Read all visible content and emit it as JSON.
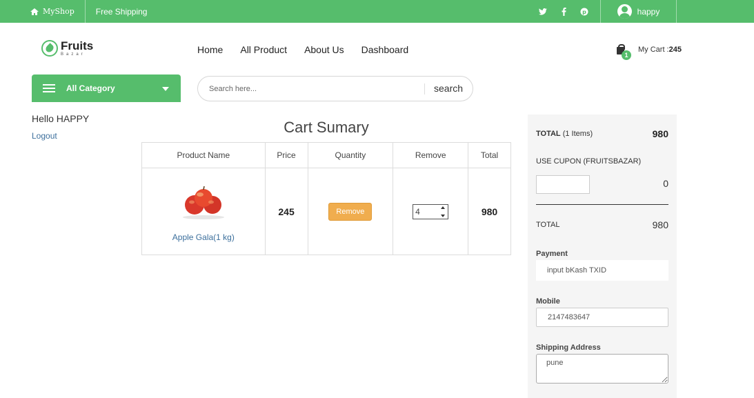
{
  "topbar": {
    "shop_name": "MyShop",
    "shipping": "Free Shipping",
    "socials": [
      "twitter-icon",
      "facebook-icon",
      "pinterest-icon"
    ],
    "username": "happy"
  },
  "header": {
    "logo_main": "Fruits",
    "logo_sub": "Bazar",
    "nav": [
      "Home",
      "All Product",
      "About Us",
      "Dashboard"
    ],
    "cart_count": "1",
    "cart_label": "My Cart :",
    "cart_total": "245"
  },
  "category": {
    "label": "All Category"
  },
  "search": {
    "placeholder": "Search here...",
    "button": "search"
  },
  "sidebar": {
    "greeting": "Hello HAPPY",
    "logout": "Logout"
  },
  "cart": {
    "title": "Cart Sumary",
    "columns": [
      "Product Name",
      "Price",
      "Quantity",
      "Remove",
      "Total"
    ],
    "items": [
      {
        "name": "Apple Gala(1 kg)",
        "price": "245",
        "action": "Remove",
        "quantity": "4",
        "total": "980"
      }
    ]
  },
  "summary": {
    "total_label": "TOTAL",
    "total_items": "(1 Items)",
    "total_value": "980",
    "coupon_label": "USE CUPON (FRUITSBAZAR)",
    "coupon_value": "0",
    "grand_label": "TOTAL",
    "grand_value": "980",
    "payment_label": "Payment",
    "payment_placeholder": "input bKash TXID",
    "mobile_label": "Mobile",
    "mobile_value": "2147483647",
    "address_label": "Shipping Address",
    "address_value": "pune"
  },
  "colors": {
    "brand_green": "#56bd6c",
    "remove_orange": "#f0ad4e",
    "link_blue": "#3c6f9c"
  }
}
